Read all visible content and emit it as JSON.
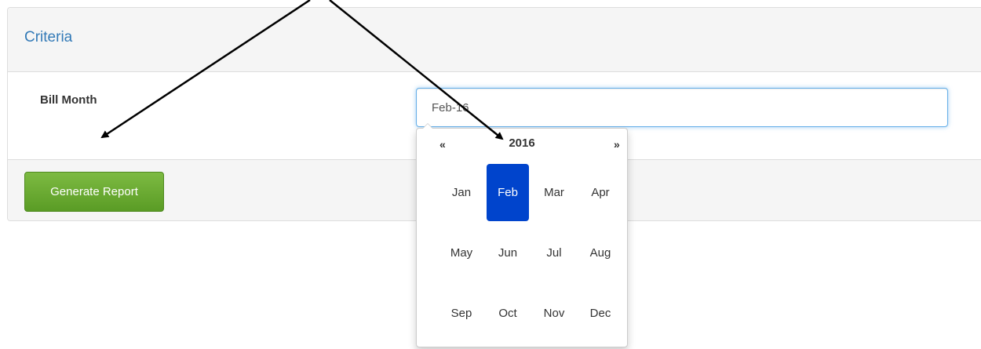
{
  "panel": {
    "title": "Criteria"
  },
  "form": {
    "bill_month_label": "Bill Month",
    "bill_month_value": "Feb-16"
  },
  "footer": {
    "generate_button_label": "Generate Report"
  },
  "datepicker": {
    "prev_label": "«",
    "next_label": "»",
    "year": "2016",
    "selected_month": "Feb",
    "months": [
      "Jan",
      "Feb",
      "Mar",
      "Apr",
      "May",
      "Jun",
      "Jul",
      "Aug",
      "Sep",
      "Oct",
      "Nov",
      "Dec"
    ]
  },
  "colors": {
    "title_blue": "#337ab7",
    "button_green": "#6aad32",
    "selected_month_bg": "#0044cc",
    "input_focus_border": "#66afe9"
  }
}
